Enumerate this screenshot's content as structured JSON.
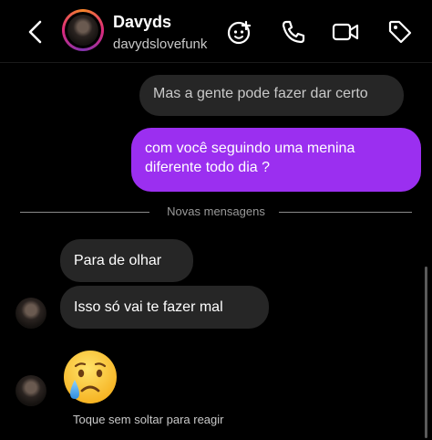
{
  "header": {
    "name": "Davyds",
    "username": "davydslovefunk"
  },
  "messages": {
    "received_top": "Mas a gente pode fazer dar certo",
    "sent": "com você seguindo uma menina diferente todo dia ?",
    "divider": "Novas mensagens",
    "received_1": "Para de olhar",
    "received_2": "Isso só vai te fazer mal",
    "emoji": "😢",
    "hint": "Toque sem soltar para reagir"
  },
  "colors": {
    "sent_bubble": "#9b2ff0",
    "received_bubble": "#262626",
    "background": "#000000"
  },
  "icons": [
    "back-arrow-icon",
    "sticker-icon",
    "phone-icon",
    "video-camera-icon",
    "tag-icon",
    "crying-emoji"
  ]
}
